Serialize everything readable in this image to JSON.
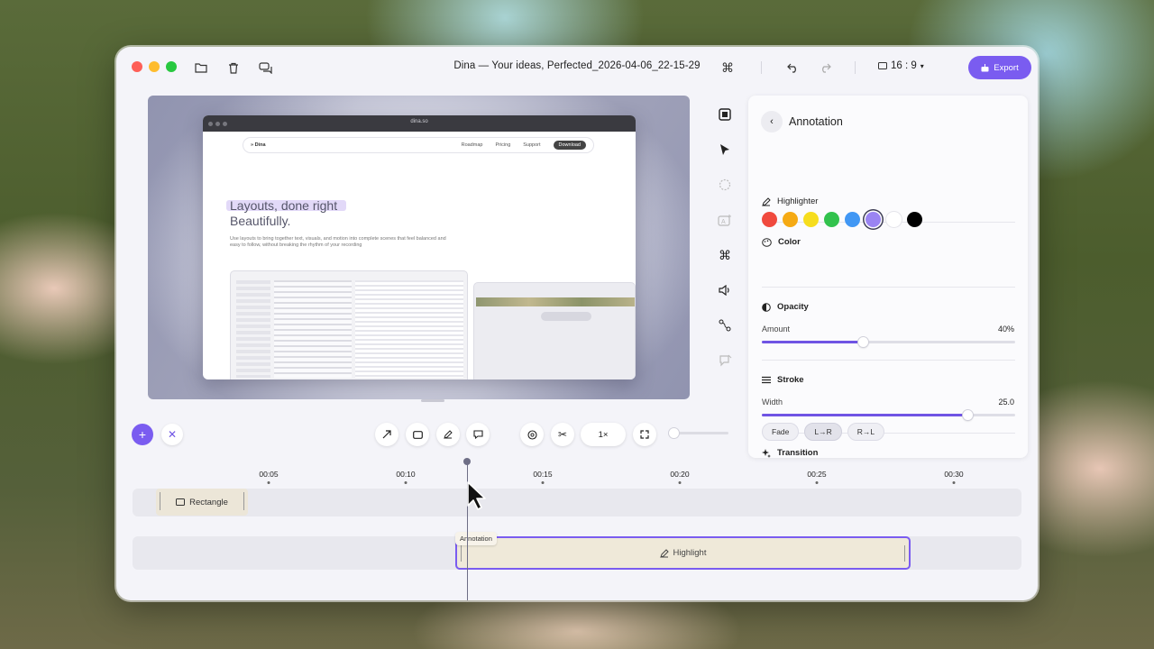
{
  "window": {
    "title": "Dina — Your ideas, Perfected_2026-04-06_22-15-29",
    "aspect_ratio": "16 : 9",
    "export_label": "Export",
    "traffic_colors": [
      "#fe5f57",
      "#febc2e",
      "#28c840"
    ]
  },
  "canvas": {
    "browser_url": "dina.so",
    "site": {
      "logo": "» Dina",
      "links": [
        "Roadmap",
        "Pricing",
        "Support"
      ],
      "download": "Download",
      "headline_1": "Layouts, done right",
      "headline_2": "Beautifully.",
      "paragraph": "Use layouts to bring together text, visuals, and motion into complete scenes that feel balanced and easy to follow, without breaking the rhythm of your recording"
    }
  },
  "right_toolbar": [
    "crop-icon",
    "cursor-icon",
    "zoom-effect-icon",
    "caption-icon",
    "command-icon",
    "audio-icon",
    "path-icon",
    "comment-icon"
  ],
  "panel": {
    "title": "Annotation",
    "tool": "Highlighter",
    "color_label": "Color",
    "colors": [
      "#f04a3e",
      "#f5aa14",
      "#f6dd1e",
      "#32c24d",
      "#4197f4",
      "#9a84f2",
      "#ffffff",
      "#000000"
    ],
    "selected_color": "#9a84f2",
    "opacity_label": "Opacity",
    "amount_label": "Amount",
    "amount_value": "40%",
    "amount_fraction": 0.4,
    "stroke_label": "Stroke",
    "width_label": "Width",
    "width_value": "25.0",
    "width_fraction": 0.81,
    "transition_label": "Transition",
    "transitions": [
      "Fade",
      "L→R",
      "R→L"
    ],
    "active_transition": "L→R"
  },
  "bottom_toolbar": {
    "speed": "1×"
  },
  "timeline": {
    "ticks": [
      "00:05",
      "00:10",
      "00:15",
      "00:20",
      "00:25",
      "00:30"
    ],
    "clip_rectangle": "Rectangle",
    "clip_highlight": "Highlight",
    "clip_tag": "Annotation"
  }
}
